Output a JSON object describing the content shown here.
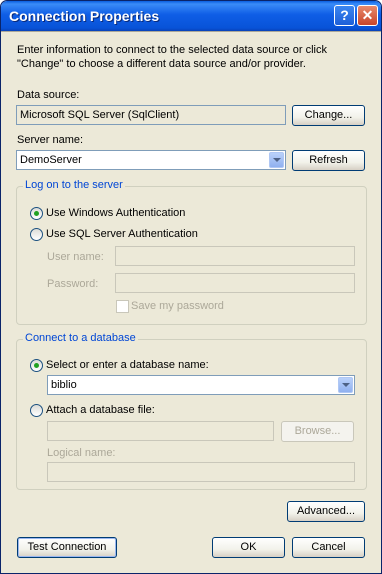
{
  "window": {
    "title": "Connection Properties",
    "help_glyph": "?",
    "close_glyph": "✕"
  },
  "intro": {
    "line1": "Enter information to connect to the selected data source or click",
    "line2": "\"Change\" to choose a different data source and/or provider."
  },
  "data_source": {
    "label": "Data source:",
    "value": "Microsoft SQL Server (SqlClient)",
    "change_button": "Change..."
  },
  "server": {
    "label": "Server name:",
    "value": "DemoServer",
    "refresh_button": "Refresh"
  },
  "logon": {
    "legend": "Log on to the server",
    "windows_auth": "Use Windows Authentication",
    "windows_auth_selected": true,
    "sql_auth": "Use SQL Server Authentication",
    "user_name_label": "User name:",
    "user_name_value": "",
    "password_label": "Password:",
    "password_value": "",
    "save_password": "Save my password",
    "save_password_checked": false
  },
  "database": {
    "legend": "Connect to a database",
    "select_option": "Select or enter a database name:",
    "select_option_selected": true,
    "database_name": "biblio",
    "attach_option": "Attach a database file:",
    "attach_file_value": "",
    "browse_button": "Browse...",
    "logical_name_label": "Logical name:",
    "logical_name_value": ""
  },
  "buttons": {
    "advanced": "Advanced...",
    "test": "Test Connection",
    "ok": "OK",
    "cancel": "Cancel"
  }
}
